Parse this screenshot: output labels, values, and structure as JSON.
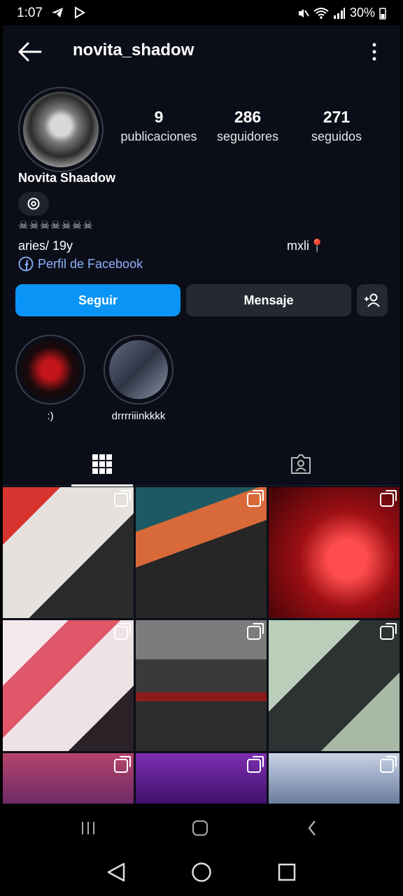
{
  "status_bar": {
    "time": "1:07",
    "battery": "30%"
  },
  "header": {
    "username": "novita_shadow"
  },
  "profile": {
    "stats": [
      {
        "value": "9",
        "label": "publicaciones"
      },
      {
        "value": "286",
        "label": "seguidores"
      },
      {
        "value": "271",
        "label": "seguidos"
      }
    ],
    "display_name": "Novita Shaadow",
    "bio_symbols": "☠☠☠☠☠☠☠",
    "bio_line": "aries/ 19y",
    "bio_location": "mxli📍",
    "facebook_link": "Perfil de Facebook"
  },
  "actions": {
    "follow": "Seguir",
    "message": "Mensaje"
  },
  "highlights": [
    {
      "label": ":)"
    },
    {
      "label": "drrrriiinkkkk"
    }
  ],
  "tabs": [
    "posts-grid-icon",
    "tagged-icon"
  ]
}
